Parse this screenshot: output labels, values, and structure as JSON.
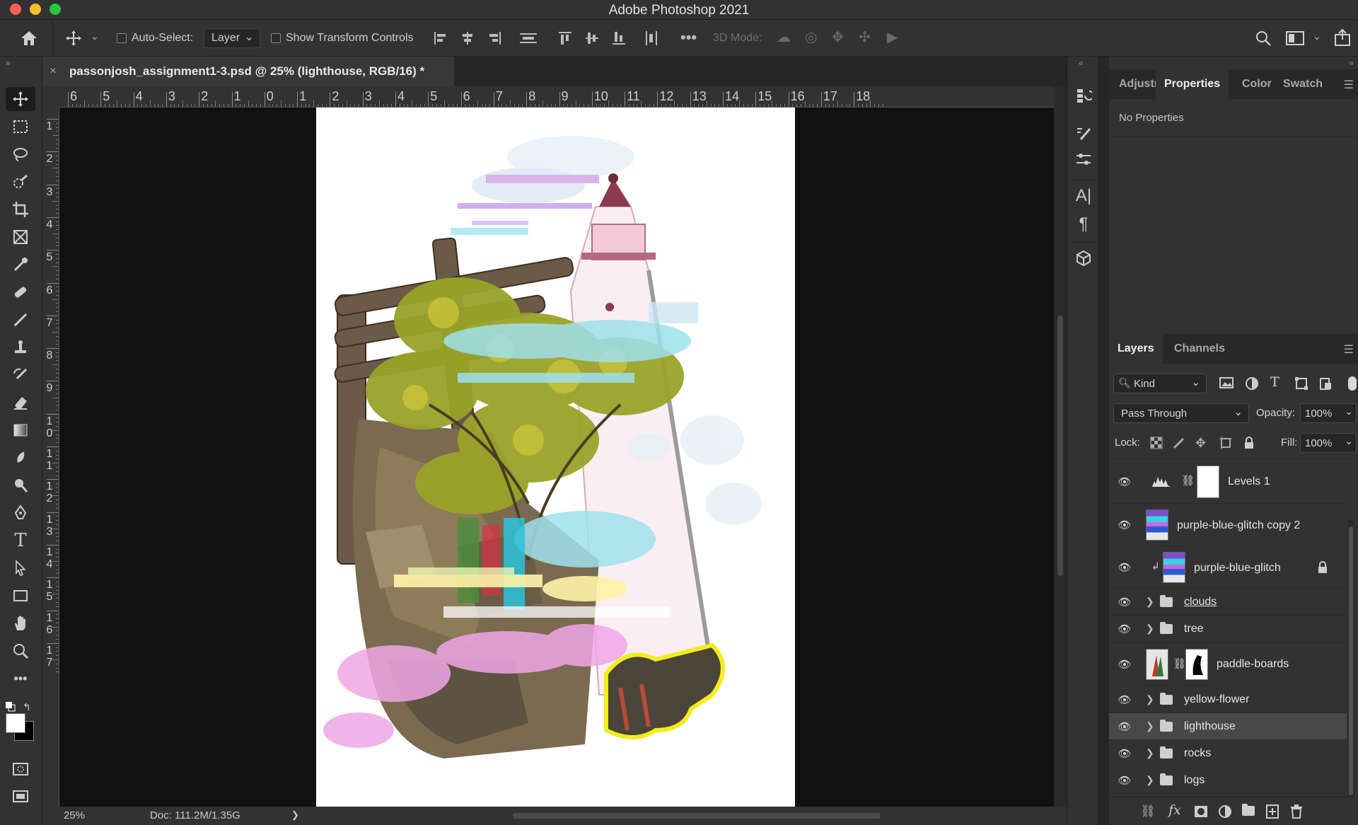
{
  "app": {
    "title": "Adobe Photoshop 2021",
    "traffic_colors": [
      "#ff5f57",
      "#febc2e",
      "#28c840"
    ]
  },
  "options_bar": {
    "auto_select_label": "Auto-Select:",
    "auto_select_checked": false,
    "auto_select_target": "Layer",
    "show_transform_label": "Show Transform Controls",
    "show_transform_checked": false,
    "mode_3d_label": "3D Mode:"
  },
  "document": {
    "tab_title": "passonjosh_assignment1-3.psd @ 25% (lighthouse, RGB/16) *",
    "close_glyph": "×"
  },
  "rulers": {
    "horizontal": [
      "6",
      "5",
      "4",
      "3",
      "2",
      "1",
      "0",
      "1",
      "2",
      "3",
      "4",
      "5",
      "6",
      "7",
      "8",
      "9",
      "10",
      "11",
      "12",
      "13",
      "14",
      "15",
      "16",
      "17",
      "18"
    ],
    "vertical": [
      "1",
      "2",
      "3",
      "4",
      "5",
      "6",
      "7",
      "8",
      "9",
      "10",
      "11",
      "12",
      "13",
      "14",
      "15",
      "16",
      "17"
    ]
  },
  "status": {
    "zoom": "25%",
    "doc_size": "Doc: 111.2M/1.35G",
    "arrow": "❯"
  },
  "properties_panel": {
    "tabs": [
      "Adjustı",
      "Properties",
      "Color",
      "Swatch"
    ],
    "active_tab": "Properties",
    "content": "No Properties"
  },
  "layers_panel": {
    "tabs": [
      "Layers",
      "Channels"
    ],
    "active_tab": "Layers",
    "filter_label": "Kind",
    "blend_mode": "Pass Through",
    "opacity_label": "Opacity:",
    "opacity_value": "100%",
    "lock_label": "Lock:",
    "fill_label": "Fill:",
    "fill_value": "100%",
    "layers": [
      {
        "name": "Levels 1",
        "type": "adjustment",
        "visible": true
      },
      {
        "name": "purple-blue-glitch copy 2",
        "type": "smart-object",
        "visible": true
      },
      {
        "name": "purple-blue-glitch",
        "type": "smart-object-clipped",
        "visible": true,
        "locked": true
      },
      {
        "name": "clouds",
        "type": "group",
        "visible": true
      },
      {
        "name": "tree",
        "type": "group",
        "visible": true
      },
      {
        "name": "paddle-boards",
        "type": "masked-layer",
        "visible": true
      },
      {
        "name": "yellow-flower",
        "type": "group",
        "visible": true
      },
      {
        "name": "lighthouse",
        "type": "group",
        "visible": true,
        "selected": true
      },
      {
        "name": "rocks",
        "type": "group",
        "visible": true
      },
      {
        "name": "logs",
        "type": "group",
        "visible": true
      }
    ]
  },
  "icons": {
    "home": "home-icon",
    "move": "move-icon",
    "search": "search-icon",
    "share": "share-icon"
  }
}
